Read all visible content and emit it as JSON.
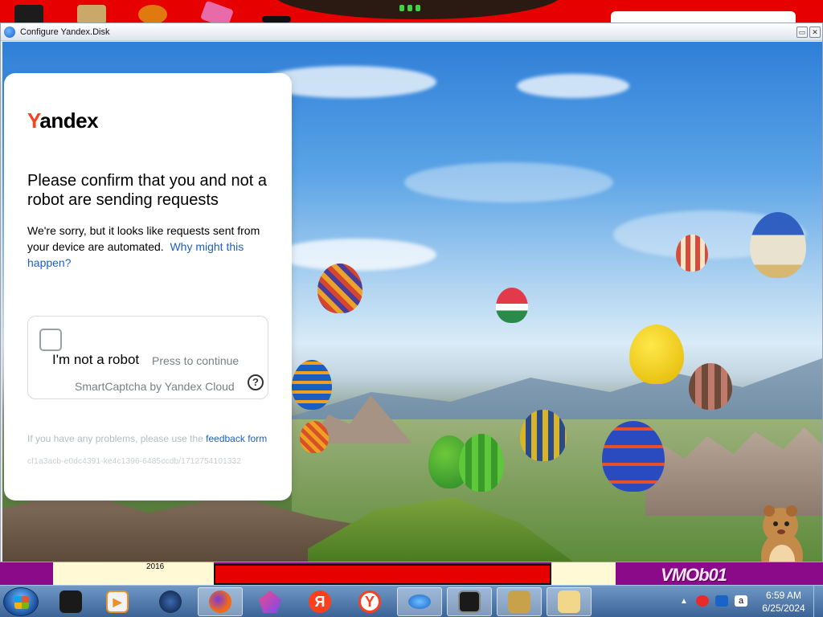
{
  "window": {
    "title": "Configure Yandex.Disk",
    "minimize_label": "▭",
    "close_label": "✕"
  },
  "captcha": {
    "logo_first": "Y",
    "logo_rest": "andex",
    "heading": "Please confirm that you and not a robot are sending requests",
    "body": "We're sorry, but it looks like requests sent from your device are automated.",
    "why_link": "Why might this happen?",
    "checkbox_label": "I'm not a robot",
    "press_label": "Press to continue",
    "provider": "SmartCaptcha by Yandex Cloud",
    "help_label": "?",
    "problem_text": "If you have any problems, please use the",
    "feedback_link": "feedback form",
    "request_id": "cf1a3acb-e0dc4391-ke4c1396-6485ccdb/1712754101332"
  },
  "desktop": {
    "year_label": "2016",
    "brand_label": "VMOb01"
  },
  "taskbar": {
    "apps": [
      {
        "name": "start-button"
      },
      {
        "name": "app-dark-box"
      },
      {
        "name": "media-player"
      },
      {
        "name": "globe-app"
      },
      {
        "name": "firefox"
      },
      {
        "name": "gem-app"
      },
      {
        "name": "yandex-red"
      },
      {
        "name": "yandex-browser"
      },
      {
        "name": "yandex-disk"
      },
      {
        "name": "monitor-app"
      },
      {
        "name": "sandbox-app"
      },
      {
        "name": "folder-app"
      }
    ],
    "yandex_glyph": "Я",
    "yandex_browser_glyph": "Y",
    "tray_lang": "a",
    "time": "6:59 AM",
    "date": "6/25/2024"
  }
}
